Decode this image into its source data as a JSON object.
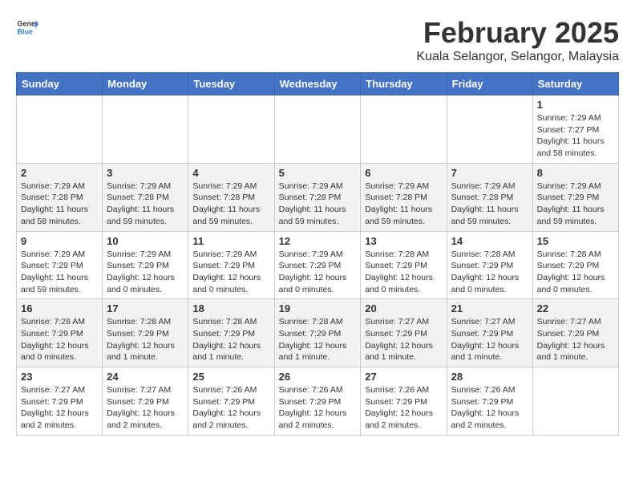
{
  "header": {
    "logo_general": "General",
    "logo_blue": "Blue",
    "title": "February 2025",
    "subtitle": "Kuala Selangor, Selangor, Malaysia"
  },
  "calendar": {
    "columns": [
      "Sunday",
      "Monday",
      "Tuesday",
      "Wednesday",
      "Thursday",
      "Friday",
      "Saturday"
    ],
    "rows": [
      {
        "cells": [
          {
            "day": "",
            "info": ""
          },
          {
            "day": "",
            "info": ""
          },
          {
            "day": "",
            "info": ""
          },
          {
            "day": "",
            "info": ""
          },
          {
            "day": "",
            "info": ""
          },
          {
            "day": "",
            "info": ""
          },
          {
            "day": "1",
            "info": "Sunrise: 7:29 AM\nSunset: 7:27 PM\nDaylight: 11 hours and 58 minutes."
          }
        ]
      },
      {
        "cells": [
          {
            "day": "2",
            "info": "Sunrise: 7:29 AM\nSunset: 7:28 PM\nDaylight: 11 hours and 58 minutes."
          },
          {
            "day": "3",
            "info": "Sunrise: 7:29 AM\nSunset: 7:28 PM\nDaylight: 11 hours and 59 minutes."
          },
          {
            "day": "4",
            "info": "Sunrise: 7:29 AM\nSunset: 7:28 PM\nDaylight: 11 hours and 59 minutes."
          },
          {
            "day": "5",
            "info": "Sunrise: 7:29 AM\nSunset: 7:28 PM\nDaylight: 11 hours and 59 minutes."
          },
          {
            "day": "6",
            "info": "Sunrise: 7:29 AM\nSunset: 7:28 PM\nDaylight: 11 hours and 59 minutes."
          },
          {
            "day": "7",
            "info": "Sunrise: 7:29 AM\nSunset: 7:28 PM\nDaylight: 11 hours and 59 minutes."
          },
          {
            "day": "8",
            "info": "Sunrise: 7:29 AM\nSunset: 7:29 PM\nDaylight: 11 hours and 59 minutes."
          }
        ]
      },
      {
        "cells": [
          {
            "day": "9",
            "info": "Sunrise: 7:29 AM\nSunset: 7:29 PM\nDaylight: 11 hours and 59 minutes."
          },
          {
            "day": "10",
            "info": "Sunrise: 7:29 AM\nSunset: 7:29 PM\nDaylight: 12 hours and 0 minutes."
          },
          {
            "day": "11",
            "info": "Sunrise: 7:29 AM\nSunset: 7:29 PM\nDaylight: 12 hours and 0 minutes."
          },
          {
            "day": "12",
            "info": "Sunrise: 7:29 AM\nSunset: 7:29 PM\nDaylight: 12 hours and 0 minutes."
          },
          {
            "day": "13",
            "info": "Sunrise: 7:28 AM\nSunset: 7:29 PM\nDaylight: 12 hours and 0 minutes."
          },
          {
            "day": "14",
            "info": "Sunrise: 7:28 AM\nSunset: 7:29 PM\nDaylight: 12 hours and 0 minutes."
          },
          {
            "day": "15",
            "info": "Sunrise: 7:28 AM\nSunset: 7:29 PM\nDaylight: 12 hours and 0 minutes."
          }
        ]
      },
      {
        "cells": [
          {
            "day": "16",
            "info": "Sunrise: 7:28 AM\nSunset: 7:29 PM\nDaylight: 12 hours and 0 minutes."
          },
          {
            "day": "17",
            "info": "Sunrise: 7:28 AM\nSunset: 7:29 PM\nDaylight: 12 hours and 1 minute."
          },
          {
            "day": "18",
            "info": "Sunrise: 7:28 AM\nSunset: 7:29 PM\nDaylight: 12 hours and 1 minute."
          },
          {
            "day": "19",
            "info": "Sunrise: 7:28 AM\nSunset: 7:29 PM\nDaylight: 12 hours and 1 minute."
          },
          {
            "day": "20",
            "info": "Sunrise: 7:27 AM\nSunset: 7:29 PM\nDaylight: 12 hours and 1 minute."
          },
          {
            "day": "21",
            "info": "Sunrise: 7:27 AM\nSunset: 7:29 PM\nDaylight: 12 hours and 1 minute."
          },
          {
            "day": "22",
            "info": "Sunrise: 7:27 AM\nSunset: 7:29 PM\nDaylight: 12 hours and 1 minute."
          }
        ]
      },
      {
        "cells": [
          {
            "day": "23",
            "info": "Sunrise: 7:27 AM\nSunset: 7:29 PM\nDaylight: 12 hours and 2 minutes."
          },
          {
            "day": "24",
            "info": "Sunrise: 7:27 AM\nSunset: 7:29 PM\nDaylight: 12 hours and 2 minutes."
          },
          {
            "day": "25",
            "info": "Sunrise: 7:26 AM\nSunset: 7:29 PM\nDaylight: 12 hours and 2 minutes."
          },
          {
            "day": "26",
            "info": "Sunrise: 7:26 AM\nSunset: 7:29 PM\nDaylight: 12 hours and 2 minutes."
          },
          {
            "day": "27",
            "info": "Sunrise: 7:26 AM\nSunset: 7:29 PM\nDaylight: 12 hours and 2 minutes."
          },
          {
            "day": "28",
            "info": "Sunrise: 7:26 AM\nSunset: 7:29 PM\nDaylight: 12 hours and 2 minutes."
          },
          {
            "day": "",
            "info": ""
          }
        ]
      }
    ]
  }
}
